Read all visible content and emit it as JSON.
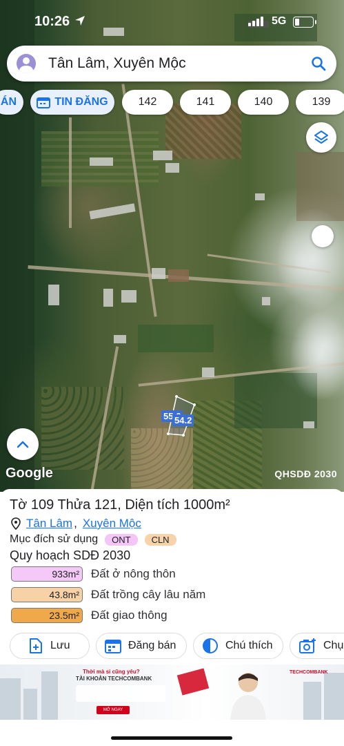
{
  "status_bar": {
    "time": "10:26",
    "network": "5G"
  },
  "search": {
    "query": "Tân Lâm, Xuyên Mộc"
  },
  "chips": [
    {
      "label": "ÁN"
    },
    {
      "label": "TIN ĐĂNG"
    },
    {
      "label": "142"
    },
    {
      "label": "141"
    },
    {
      "label": "140"
    },
    {
      "label": "139"
    }
  ],
  "map": {
    "attribution": "Google",
    "layer_label": "QHSDĐ 2030",
    "parcel_labels": [
      "55.6",
      "54.2"
    ]
  },
  "sheet": {
    "title": "Tờ 109 Thửa 121, Diện tích 1000m²",
    "address": {
      "ward": "Tân Lâm",
      "separator": ",",
      "district": "Xuyên Mộc"
    },
    "purpose_label": "Mục đích sử dụng",
    "purpose_tags": [
      {
        "code": "ONT",
        "color": "#f3c6f7"
      },
      {
        "code": "CLN",
        "color": "#f6d3a8"
      }
    ],
    "plan_title": "Quy hoạch SDĐ 2030",
    "land_uses": [
      {
        "area": "933m²",
        "label": "Đất ở nông thôn",
        "color": "#f4c8f7"
      },
      {
        "area": "43.8m²",
        "label": "Đất trồng cây lâu năm",
        "color": "#f6d2a6"
      },
      {
        "area": "23.5m²",
        "label": "Đất giao thông",
        "color": "#f0a94a"
      }
    ],
    "actions": [
      {
        "label": "Lưu",
        "icon": "add-file-icon"
      },
      {
        "label": "Đăng bán",
        "icon": "calendar-icon"
      },
      {
        "label": "Chú thích",
        "icon": "contrast-icon"
      },
      {
        "label": "Chụ",
        "icon": "camera-icon"
      }
    ]
  },
  "ad": {
    "headline": "Thời mà si cũng yêu?",
    "subline": "TÀI KHOẢN TECHCOMBANK",
    "cta": "MỞ NGAY",
    "brand": "TECHCOMBANK"
  }
}
